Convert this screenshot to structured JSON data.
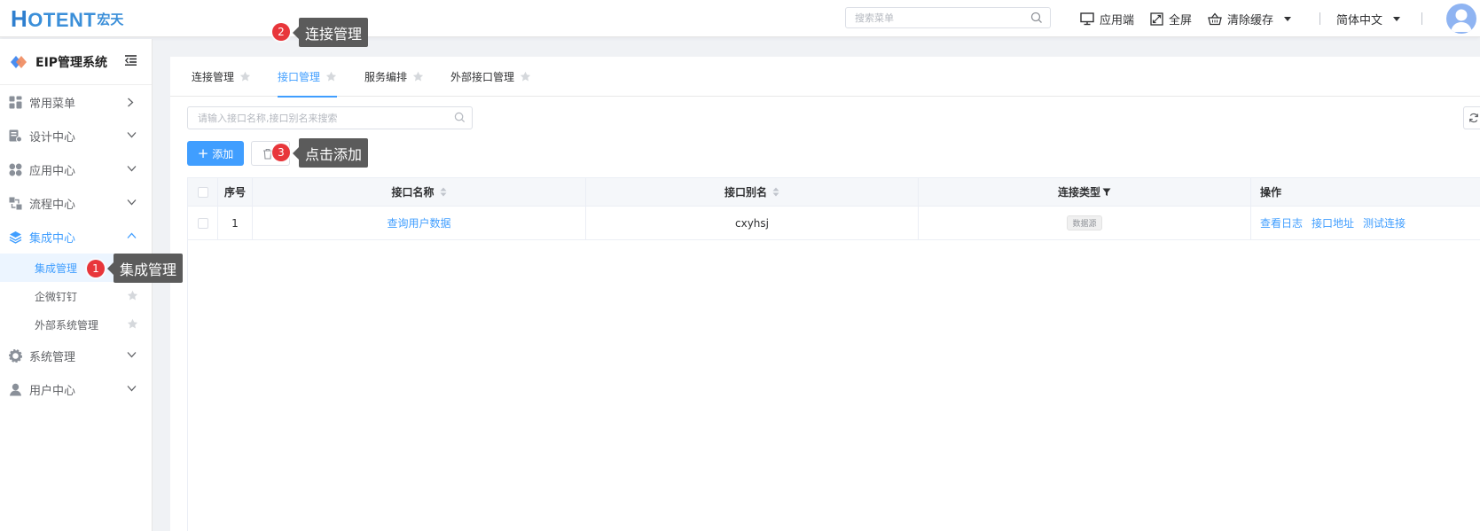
{
  "header": {
    "logo_text": "OTENT",
    "logo_letter": "H",
    "logo_cn": "宏天",
    "search_placeholder": "搜索菜单",
    "actions": {
      "client": "应用端",
      "fullscreen": "全屏",
      "clear_cache": "清除缓存",
      "language": "简体中文"
    }
  },
  "sidebar": {
    "system_title": "EIP管理系统",
    "menus": [
      {
        "label": "常用菜单"
      },
      {
        "label": "设计中心"
      },
      {
        "label": "应用中心"
      },
      {
        "label": "流程中心"
      },
      {
        "label": "集成中心"
      },
      {
        "label": "系统管理"
      },
      {
        "label": "用户中心"
      }
    ],
    "sub_items": [
      {
        "label": "集成管理"
      },
      {
        "label": "企微钉钉"
      },
      {
        "label": "外部系统管理"
      }
    ]
  },
  "tabs": [
    {
      "label": "连接管理"
    },
    {
      "label": "接口管理"
    },
    {
      "label": "服务编排"
    },
    {
      "label": "外部接口管理"
    }
  ],
  "filter": {
    "placeholder": "请输入接口名称,接口别名来搜索"
  },
  "toolbar": {
    "add_label": "添加"
  },
  "table": {
    "columns": {
      "index": "序号",
      "name": "接口名称",
      "alias": "接口别名",
      "type": "连接类型",
      "ops": "操作"
    },
    "rows": [
      {
        "index": "1",
        "name": "查询用户数据",
        "alias": "cxyhsj",
        "type": "数据源",
        "ops": [
          "查看日志",
          "接口地址",
          "测试连接"
        ]
      }
    ]
  },
  "annotations": [
    {
      "number": "1",
      "text": "集成管理"
    },
    {
      "number": "2",
      "text": "连接管理"
    },
    {
      "number": "3",
      "text": "点击添加"
    }
  ],
  "colors": {
    "primary": "#409eff",
    "badge": "#e8363b",
    "tooltip": "#5b5b5b"
  }
}
